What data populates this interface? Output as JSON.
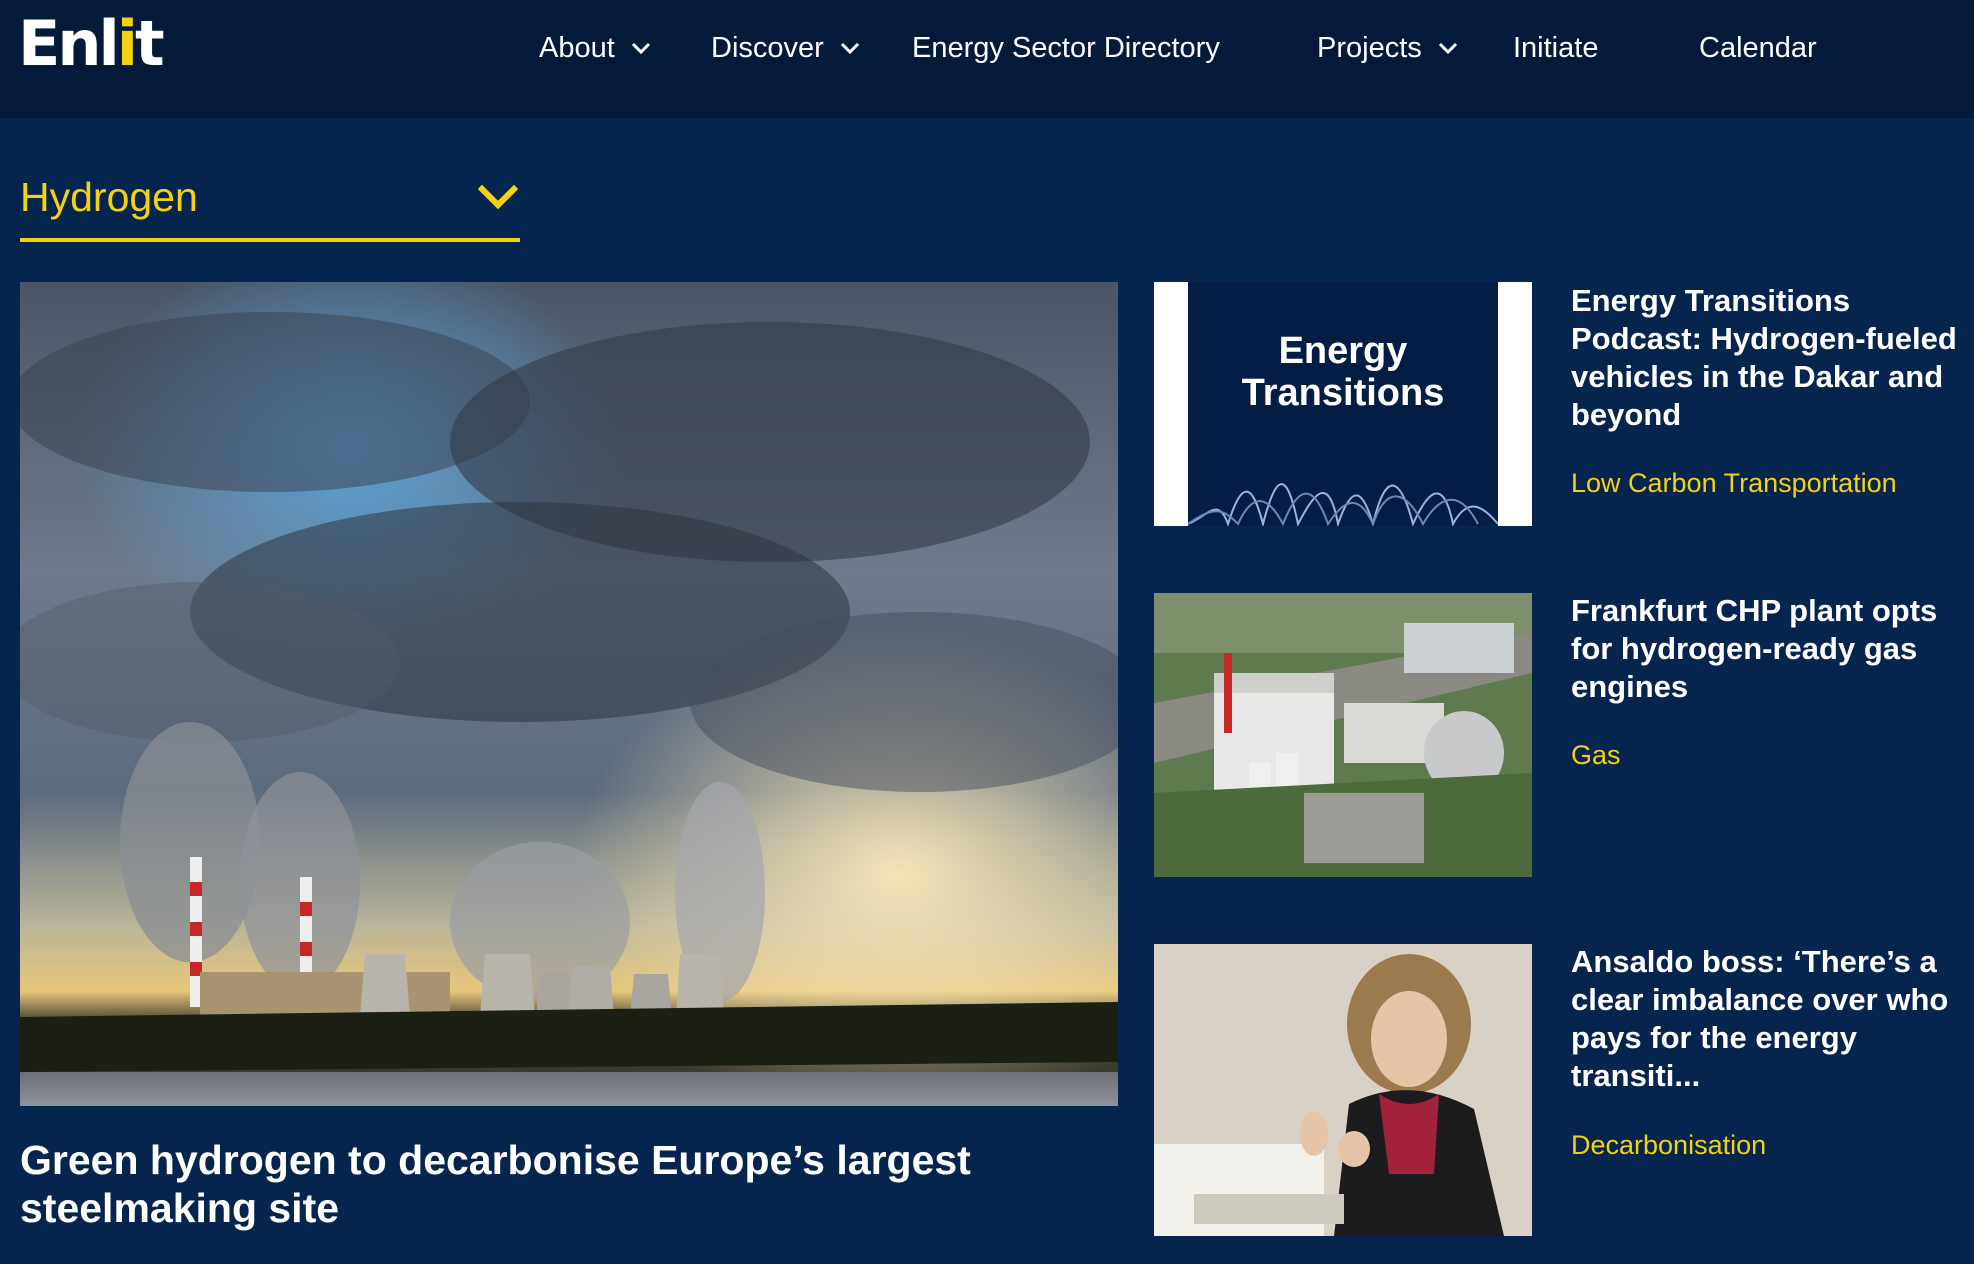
{
  "brand": {
    "logo_text": "Enlit"
  },
  "nav": {
    "items": [
      {
        "label": "About",
        "has_dropdown": true
      },
      {
        "label": "Discover",
        "has_dropdown": true
      },
      {
        "label": "Energy Sector Directory",
        "has_dropdown": false
      },
      {
        "label": "Projects",
        "has_dropdown": true
      },
      {
        "label": "Initiate",
        "has_dropdown": false
      },
      {
        "label": "Calendar",
        "has_dropdown": false
      }
    ]
  },
  "topic_filter": {
    "selected": "Hydrogen"
  },
  "featured": {
    "title": "Green hydrogen to decarbonise Europe’s largest steelmaking site"
  },
  "articles": [
    {
      "title": "Energy Transitions Podcast: Hydrogen-fueled vehicles in the Dakar and beyond",
      "tag": "Low Carbon Transportation",
      "thumb_text": "Energy Transitions"
    },
    {
      "title": "Frankfurt CHP plant opts for hydrogen-ready gas engines",
      "tag": "Gas"
    },
    {
      "title": "Ansaldo boss: ‘There’s a clear imbalance over who pays for the energy transiti...",
      "tag": "Decarbonisation"
    }
  ],
  "colors": {
    "background": "#05254f",
    "topbar": "#031a3a",
    "accent_yellow": "#f5d20f",
    "text": "#ffffff"
  },
  "icons": {
    "nav_dropdown": "chevron-down-icon",
    "topic_dropdown": "chevron-down-icon"
  }
}
